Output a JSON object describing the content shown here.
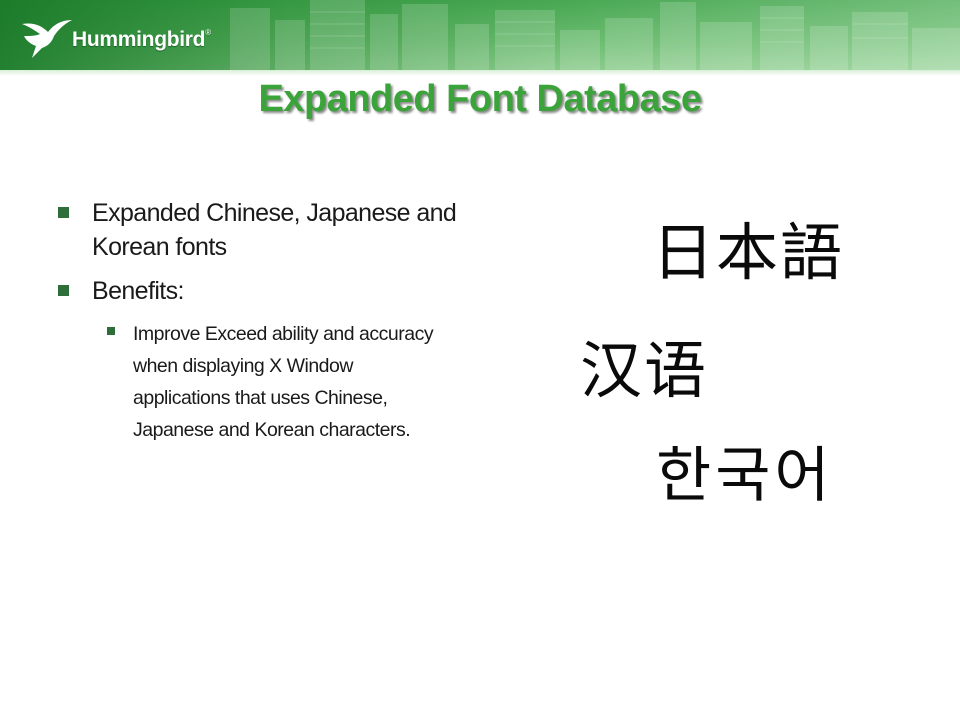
{
  "header": {
    "brand": "Hummingbird",
    "brand_mark": "®",
    "logo_icon": "hummingbird-icon",
    "colors": {
      "banner": "#2e9a3c",
      "title": "#3aa33a",
      "bullet": "#2f6e3a"
    }
  },
  "slide": {
    "title": "Expanded Font Database",
    "bullets": [
      {
        "text": "Expanded Chinese, Japanese and Korean fonts"
      },
      {
        "text": "Benefits:",
        "sub_bullets": [
          "Improve Exceed ability and accuracy when displaying X Window applications that uses Chinese, Japanese and Korean characters."
        ]
      }
    ],
    "language_samples": {
      "japanese": "日本語",
      "chinese": "汉语",
      "korean": "한국어"
    }
  }
}
